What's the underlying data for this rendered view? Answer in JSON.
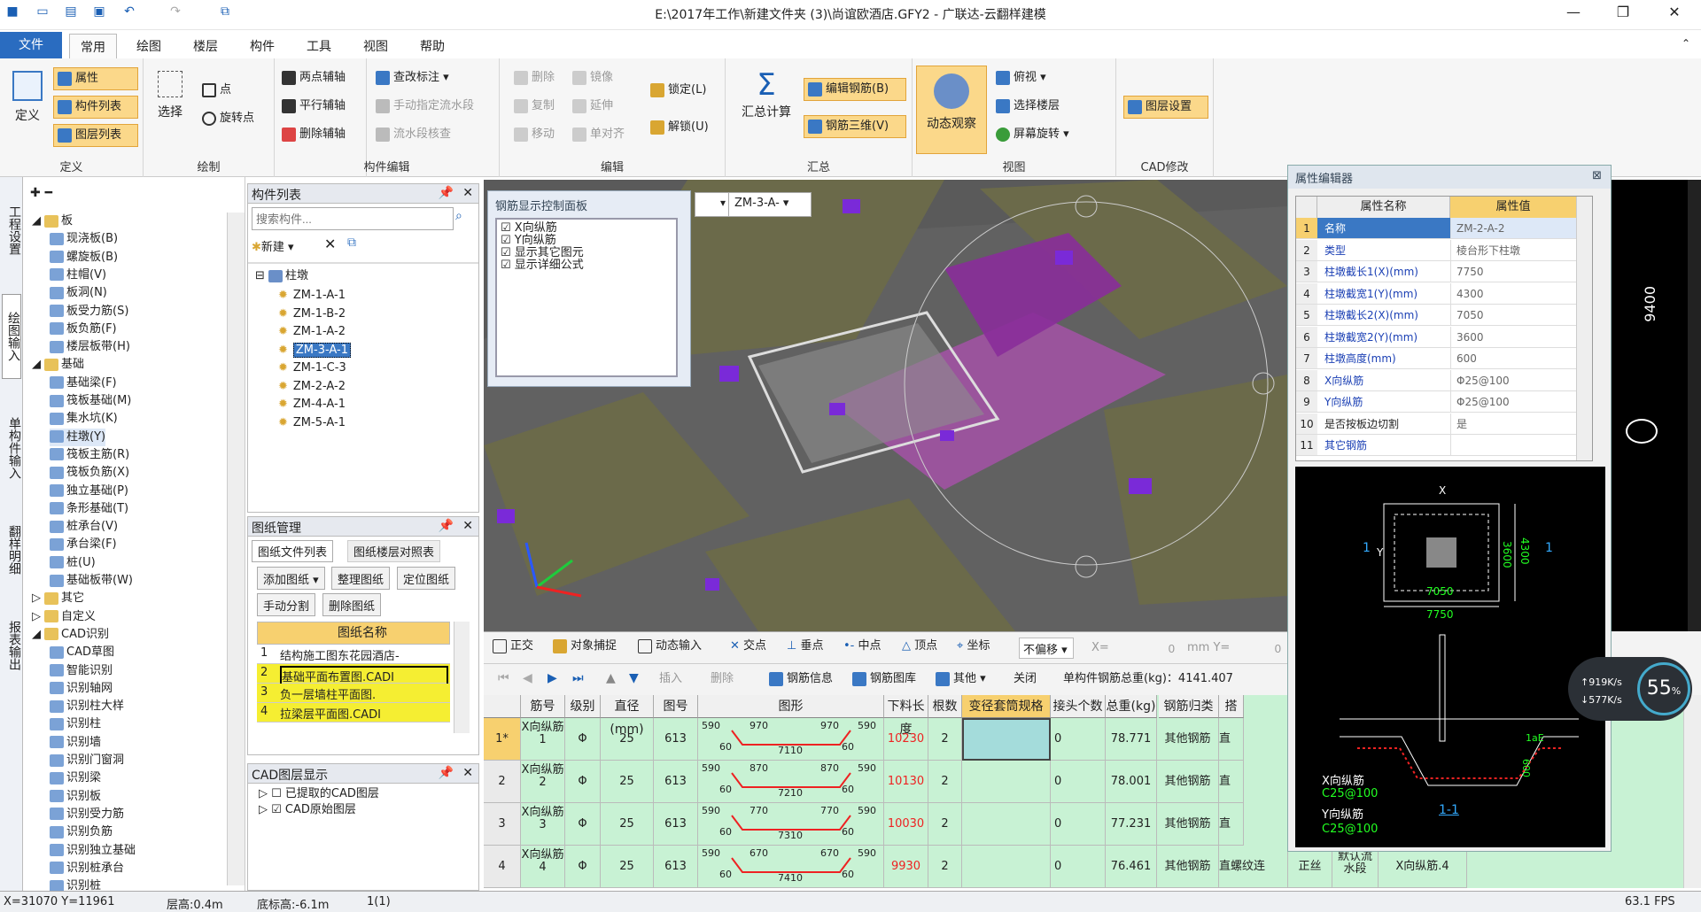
{
  "window": {
    "title": "E:\\2017年工作\\新建文件夹 (3)\\尚谊欧酒店.GFY2 - 广联达-云翻样建模"
  },
  "tabs": [
    {
      "label": "文件"
    },
    {
      "label": "常用"
    },
    {
      "label": "绘图"
    },
    {
      "label": "楼层"
    },
    {
      "label": "构件"
    },
    {
      "label": "工具"
    },
    {
      "label": "视图"
    },
    {
      "label": "帮助"
    }
  ],
  "ribbon": {
    "define": {
      "label": "定义",
      "attr": "属性",
      "comp_list": "构件列表",
      "layer_list": "图层列表",
      "group": "定义"
    },
    "draw": {
      "select": "选择",
      "point": "点",
      "rotate_point": "旋转点",
      "group": "绘制"
    },
    "axis": {
      "two_point": "两点辅轴",
      "parallel": "平行辅轴",
      "delete": "删除辅轴",
      "group": "构件编辑"
    },
    "check": {
      "check_mark": "查改标注",
      "manual_flow": "手动指定流水段",
      "flow_check": "流水段核查"
    },
    "edit": {
      "delete": "删除",
      "copy": "复制",
      "move": "移动",
      "mirror": "镜像",
      "extend": "延伸",
      "single_align": "单对齐",
      "lock": "锁定(L)",
      "unlock": "解锁(U)",
      "group": "编辑"
    },
    "summary": {
      "calc": "汇总计算",
      "edit_rebar": "编辑钢筋(B)",
      "rebar_3d": "钢筋三维(V)",
      "group": "汇总"
    },
    "view": {
      "dynamic": "动态观察",
      "top_view": "俯视",
      "select_floor": "选择楼层",
      "screen_rotate": "屏幕旋转",
      "group": "视图"
    },
    "cad": {
      "layer_settings": "图层设置",
      "group": "CAD修改"
    }
  },
  "vstrip": [
    "工程设置",
    "绘图输入",
    "单构件输入",
    "翻样明细",
    "报表输出"
  ],
  "tree": [
    {
      "label": "板",
      "level": 0,
      "folder": true
    },
    {
      "label": "现浇板(B)",
      "level": 2
    },
    {
      "label": "螺旋板(B)",
      "level": 2
    },
    {
      "label": "柱帽(V)",
      "level": 2
    },
    {
      "label": "板洞(N)",
      "level": 2
    },
    {
      "label": "板受力筋(S)",
      "level": 2
    },
    {
      "label": "板负筋(F)",
      "level": 2
    },
    {
      "label": "楼层板带(H)",
      "level": 2
    },
    {
      "label": "基础",
      "level": 0,
      "folder": true
    },
    {
      "label": "基础梁(F)",
      "level": 2
    },
    {
      "label": "筏板基础(M)",
      "level": 2
    },
    {
      "label": "集水坑(K)",
      "level": 2
    },
    {
      "label": "柱墩(Y)",
      "level": 2,
      "selected": true
    },
    {
      "label": "筏板主筋(R)",
      "level": 2
    },
    {
      "label": "筏板负筋(X)",
      "level": 2
    },
    {
      "label": "独立基础(P)",
      "level": 2
    },
    {
      "label": "条形基础(T)",
      "level": 2
    },
    {
      "label": "桩承台(V)",
      "level": 2
    },
    {
      "label": "承台梁(F)",
      "level": 2
    },
    {
      "label": "桩(U)",
      "level": 2
    },
    {
      "label": "基础板带(W)",
      "level": 2
    },
    {
      "label": "其它",
      "level": 0,
      "folder": true
    },
    {
      "label": "自定义",
      "level": 0,
      "folder": true
    },
    {
      "label": "CAD识别",
      "level": 0,
      "folder": true
    },
    {
      "label": "CAD草图",
      "level": 2
    },
    {
      "label": "智能识别",
      "level": 2
    },
    {
      "label": "识别轴网",
      "level": 2
    },
    {
      "label": "识别柱大样",
      "level": 2
    },
    {
      "label": "识别柱",
      "level": 2
    },
    {
      "label": "识别墙",
      "level": 2
    },
    {
      "label": "识别门窗洞",
      "level": 2
    },
    {
      "label": "识别梁",
      "level": 2
    },
    {
      "label": "识别板",
      "level": 2
    },
    {
      "label": "识别受力筋",
      "level": 2
    },
    {
      "label": "识别负筋",
      "level": 2
    },
    {
      "label": "识别独立基础",
      "level": 2
    },
    {
      "label": "识别桩承台",
      "level": 2
    },
    {
      "label": "识别桩",
      "level": 2
    }
  ],
  "comp_list": {
    "title": "构件列表",
    "search_placeholder": "搜索构件...",
    "new": "新建",
    "root": "柱墩",
    "items": [
      "ZM-1-A-1",
      "ZM-1-B-2",
      "ZM-1-A-2",
      "ZM-3-A-1",
      "ZM-1-C-3",
      "ZM-2-A-2",
      "ZM-4-A-1",
      "ZM-5-A-1"
    ],
    "selected_index": 3
  },
  "drawings": {
    "title": "图纸管理",
    "tab1": "图纸文件列表",
    "tab2": "图纸楼层对照表",
    "add": "添加图纸",
    "organize": "整理图纸",
    "locate": "定位图纸",
    "manual_split": "手动分割",
    "delete": "删除图纸",
    "col": "图纸名称",
    "rows": [
      {
        "n": "1",
        "name": "结构施工图东花园酒店-"
      },
      {
        "n": "2",
        "name": "基础平面布置图.CADI"
      },
      {
        "n": "3",
        "name": "负一层墙柱平面图."
      },
      {
        "n": "4",
        "name": "拉梁层平面图.CADI"
      }
    ]
  },
  "cad_layers": {
    "title": "CAD图层显示",
    "items": [
      "已提取的CAD图层",
      "CAD原始图层"
    ]
  },
  "rebar_panel": {
    "title": "钢筋显示控制面板",
    "items": [
      "X向纵筋",
      "Y向纵筋",
      "显示其它图元",
      "显示详细公式"
    ],
    "dropdown": "ZM-3-A-"
  },
  "view_toolbar": {
    "ortho": "正交",
    "snap": "对象捕捉",
    "dynamic_input": "动态输入",
    "intersection": "交点",
    "perpendicular": "垂点",
    "midpoint": "中点",
    "vertex": "顶点",
    "coord": "坐标",
    "offset_mode": "不偏移",
    "x_label": "X=",
    "x_value": "0",
    "mm_label": "mm Y=",
    "y_value": "0"
  },
  "table_toolbar": {
    "insert": "插入",
    "delete": "删除",
    "rebar_info": "钢筋信息",
    "rebar_lib": "钢筋图库",
    "other": "其他",
    "close": "关闭",
    "total": "单构件钢筋总重(kg)：4141.407"
  },
  "table": {
    "headers": [
      "筋号",
      "级别",
      "直径(mm)",
      "图号",
      "图形",
      "下料长度",
      "根数",
      "变径套筒规格",
      "接头个数",
      "总重(kg)",
      "钢筋归类",
      "搭"
    ],
    "rows": [
      {
        "idx": "1*",
        "name": "X向纵筋1",
        "grade": "Φ",
        "dia": "25",
        "fig": "613",
        "a": "590",
        "b": "970",
        "c": "970",
        "d": "590",
        "e": "60",
        "f": "7110",
        "g": "60",
        "len": "10230",
        "count": "2",
        "joints": "0",
        "weight": "78.771",
        "cat": "其他钢筋",
        "lap": "直"
      },
      {
        "idx": "2",
        "name": "X向纵筋2",
        "grade": "Φ",
        "dia": "25",
        "fig": "613",
        "a": "590",
        "b": "870",
        "c": "870",
        "d": "590",
        "e": "60",
        "f": "7210",
        "g": "60",
        "len": "10130",
        "count": "2",
        "joints": "0",
        "weight": "78.001",
        "cat": "其他钢筋",
        "lap": "直"
      },
      {
        "idx": "3",
        "name": "X向纵筋3",
        "grade": "Φ",
        "dia": "25",
        "fig": "613",
        "a": "590",
        "b": "770",
        "c": "770",
        "d": "590",
        "e": "60",
        "f": "7310",
        "g": "60",
        "len": "10030",
        "count": "2",
        "joints": "0",
        "weight": "77.231",
        "cat": "其他钢筋",
        "lap": "直"
      },
      {
        "idx": "4",
        "name": "X向纵筋4",
        "grade": "Φ",
        "dia": "25",
        "fig": "613",
        "a": "590",
        "b": "670",
        "c": "670",
        "d": "590",
        "e": "60",
        "f": "7410",
        "g": "60",
        "len": "9930",
        "count": "2",
        "joints": "0",
        "weight": "76.461",
        "cat": "其他钢筋",
        "lap": "直螺纹连",
        "extra1": "正丝",
        "extra2": "默认流水段",
        "extra3": "X向纵筋.4"
      }
    ]
  },
  "prop_editor": {
    "title": "属性编辑器",
    "col_name": "属性名称",
    "col_value": "属性值",
    "rows": [
      {
        "n": "1",
        "name": "名称",
        "value": "ZM-2-A-2"
      },
      {
        "n": "2",
        "name": "类型",
        "value": "棱台形下柱墩"
      },
      {
        "n": "3",
        "name": "柱墩截长1(X)(mm)",
        "value": "7750"
      },
      {
        "n": "4",
        "name": "柱墩截宽1(Y)(mm)",
        "value": "4300"
      },
      {
        "n": "5",
        "name": "柱墩截长2(X)(mm)",
        "value": "7050"
      },
      {
        "n": "6",
        "name": "柱墩截宽2(Y)(mm)",
        "value": "3600"
      },
      {
        "n": "7",
        "name": "柱墩高度(mm)",
        "value": "600"
      },
      {
        "n": "8",
        "name": "X向纵筋",
        "value": "Φ25@100"
      },
      {
        "n": "9",
        "name": "Y向纵筋",
        "value": "Φ25@100"
      },
      {
        "n": "10",
        "name": "是否按板边切割",
        "value": "是"
      },
      {
        "n": "11",
        "name": "其它钢筋",
        "value": ""
      }
    ],
    "diagram": {
      "x": "X",
      "y": "Y",
      "d7050": "7050",
      "d7750": "7750",
      "d3600": "3600",
      "d4300": "4300",
      "sec": "1",
      "xlbl": "X向纵筋",
      "xval": "C25@100",
      "ylbl": "Y向纵筋",
      "yval": "C25@100",
      "cut": "1-1",
      "lae": "1aE",
      "h600": "600"
    }
  },
  "net": {
    "up": "919K/s",
    "down": "577K/s",
    "pct": "55",
    "pct_sign": "%"
  },
  "cad_right": {
    "dim": "9400"
  },
  "status": {
    "coords": "X=31070 Y=11961",
    "floor_height": "层高:0.4m",
    "base_elev": "底标高:-6.1m",
    "count": "1(1)",
    "fps": "63.1 FPS"
  }
}
